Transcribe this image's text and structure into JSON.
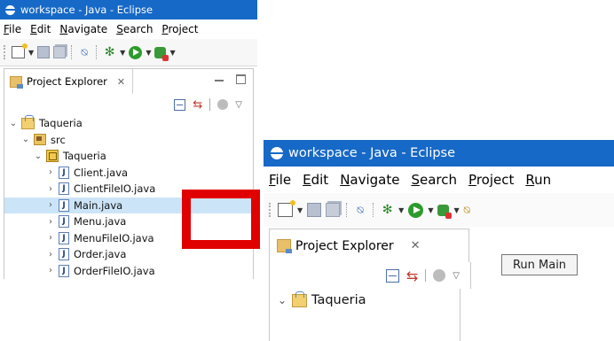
{
  "colors": {
    "titlebar": "#1769c7",
    "selection": "#cce4f7",
    "highlight": "#e00000"
  },
  "left_window": {
    "title": "workspace - Java - Eclipse",
    "menu": [
      "File",
      "Edit",
      "Navigate",
      "Search",
      "Project"
    ],
    "view_tab": {
      "label": "Project Explorer",
      "close_glyph": "✕"
    },
    "tree": [
      {
        "label": "Taqueria",
        "icon": "java-project-icon",
        "twisty": "⌄",
        "level": 0
      },
      {
        "label": "src",
        "icon": "source-folder-icon",
        "twisty": "⌄",
        "level": 1
      },
      {
        "label": "Taqueria",
        "icon": "package-icon",
        "twisty": "⌄",
        "level": 2
      },
      {
        "label": "Client.java",
        "icon": "java-file-icon",
        "twisty": "›",
        "level": 3
      },
      {
        "label": "ClientFileIO.java",
        "icon": "java-file-icon",
        "twisty": "›",
        "level": 3
      },
      {
        "label": "Main.java",
        "icon": "java-file-icon",
        "twisty": "›",
        "level": 3,
        "selected": true
      },
      {
        "label": "Menu.java",
        "icon": "java-file-icon",
        "twisty": "›",
        "level": 3
      },
      {
        "label": "MenuFileIO.java",
        "icon": "java-file-icon",
        "twisty": "›",
        "level": 3
      },
      {
        "label": "Order.java",
        "icon": "java-file-icon",
        "twisty": "›",
        "level": 3
      },
      {
        "label": "OrderFileIO.java",
        "icon": "java-file-icon",
        "twisty": "›",
        "level": 3
      }
    ]
  },
  "right_window": {
    "title": "workspace - Java - Eclipse",
    "menu": [
      "File",
      "Edit",
      "Navigate",
      "Search",
      "Project",
      "Run"
    ],
    "view_tab": {
      "label": "Project Explorer",
      "close_glyph": "✕"
    },
    "tooltip": "Run Main",
    "tree": [
      {
        "label": "Taqueria",
        "icon": "java-project-icon",
        "twisty": "⌄",
        "level": 0
      }
    ]
  },
  "glyphs": {
    "caret": "▼",
    "skip": "⍉",
    "debug": "✻",
    "link": "⇆",
    "view_menu": "▽"
  }
}
